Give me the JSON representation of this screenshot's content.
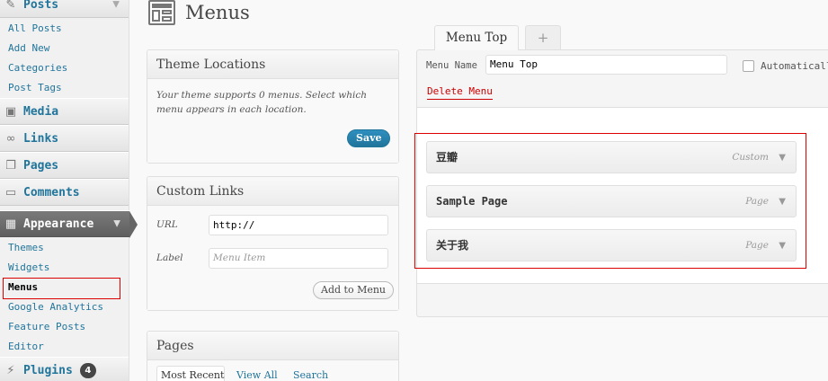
{
  "sidebar": {
    "posts": {
      "label": "Posts",
      "icon": "pin-icon"
    },
    "posts_items": [
      "All Posts",
      "Add New",
      "Categories",
      "Post Tags"
    ],
    "media": {
      "label": "Media",
      "icon": "media-icon"
    },
    "links": {
      "label": "Links",
      "icon": "link-icon"
    },
    "pages": {
      "label": "Pages",
      "icon": "pages-icon"
    },
    "comments": {
      "label": "Comments",
      "icon": "comment-icon"
    },
    "appearance": {
      "label": "Appearance",
      "icon": "appearance-icon"
    },
    "appearance_items": [
      "Themes",
      "Widgets",
      "Menus",
      "Google Analytics",
      "Feature Posts",
      "Editor"
    ],
    "plugins": {
      "label": "Plugins",
      "icon": "plugin-icon",
      "badge": "4"
    }
  },
  "header": {
    "title": "Menus",
    "icon": "menus-screen-icon"
  },
  "theme_locations": {
    "title": "Theme Locations",
    "text": "Your theme supports 0 menus. Select which menu appears in each location.",
    "save_label": "Save"
  },
  "custom_links": {
    "title": "Custom Links",
    "url_label": "URL",
    "url_value": "http://",
    "label_label": "Label",
    "label_placeholder": "Menu Item",
    "add_label": "Add to Menu"
  },
  "pages_box": {
    "title": "Pages",
    "tabs": [
      "Most Recent",
      "View All",
      "Search"
    ]
  },
  "tabs": {
    "active": "Menu Top",
    "add": "+"
  },
  "menu_editor": {
    "name_label": "Menu Name",
    "name_value": "Menu Top",
    "auto_label": "Automatically",
    "delete_label": "Delete Menu",
    "items": [
      {
        "title": "豆瓣",
        "type": "Custom"
      },
      {
        "title": "Sample Page",
        "type": "Page"
      },
      {
        "title": "关于我",
        "type": "Page"
      }
    ]
  },
  "colors": {
    "link": "#21759b",
    "highlight": "#dd0000",
    "primary_button": "#21759b"
  }
}
